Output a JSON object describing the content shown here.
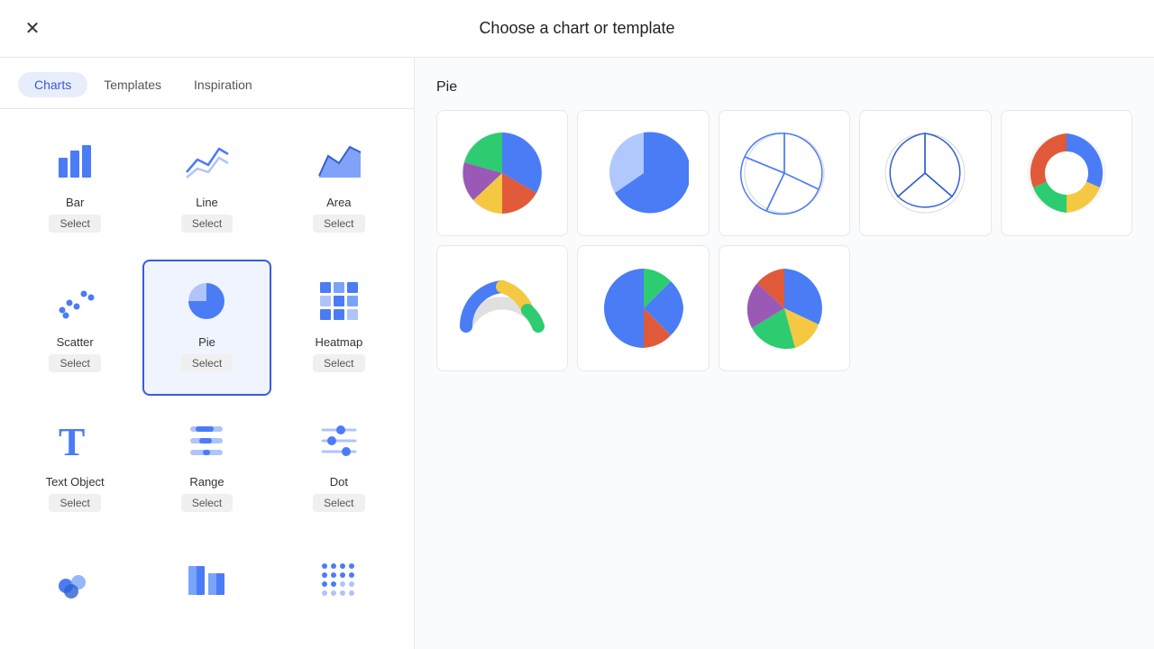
{
  "header": {
    "title": "Choose a chart or template",
    "close_label": "×"
  },
  "tabs": [
    {
      "id": "charts",
      "label": "Charts",
      "active": true
    },
    {
      "id": "templates",
      "label": "Templates",
      "active": false
    },
    {
      "id": "inspiration",
      "label": "Inspiration",
      "active": false
    }
  ],
  "charts": [
    {
      "id": "bar",
      "name": "Bar",
      "select": "Select"
    },
    {
      "id": "line",
      "name": "Line",
      "select": "Select"
    },
    {
      "id": "area",
      "name": "Area",
      "select": "Select"
    },
    {
      "id": "scatter",
      "name": "Scatter",
      "select": "Select"
    },
    {
      "id": "pie",
      "name": "Pie",
      "select": "Select",
      "selected": true
    },
    {
      "id": "heatmap",
      "name": "Heatmap",
      "select": "Select"
    },
    {
      "id": "text",
      "name": "Text Object",
      "select": "Select"
    },
    {
      "id": "range",
      "name": "Range",
      "select": "Select"
    },
    {
      "id": "dot",
      "name": "Dot",
      "select": "Select"
    }
  ],
  "pie_section": {
    "title": "Pie",
    "variants": [
      {
        "id": "pie1",
        "type": "colorful-pie"
      },
      {
        "id": "pie2",
        "type": "blue-pie"
      },
      {
        "id": "pie3",
        "type": "outline-pie"
      },
      {
        "id": "pie4",
        "type": "minimal-pie"
      },
      {
        "id": "pie5",
        "type": "donut"
      },
      {
        "id": "pie6",
        "type": "arc"
      },
      {
        "id": "pie7",
        "type": "multi-colorful"
      },
      {
        "id": "pie8",
        "type": "full-colorful"
      }
    ]
  }
}
